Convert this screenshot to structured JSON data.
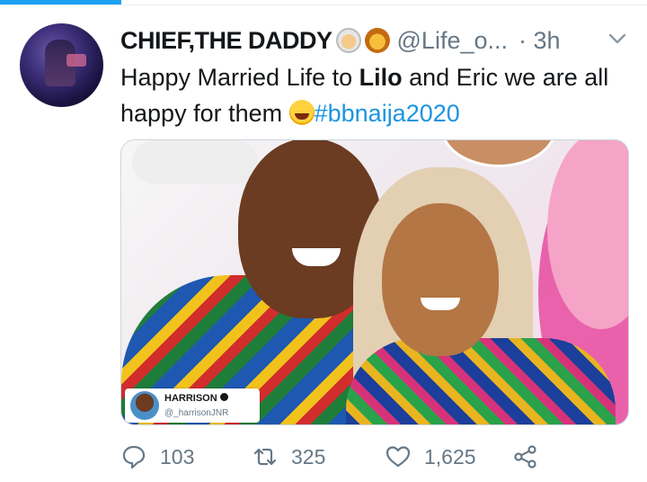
{
  "tweet": {
    "display_name": "CHIEF,THE DADDY",
    "handle": "@Life_o...",
    "separator": "·",
    "time": "3h",
    "text_part1": "Happy Married Life to ",
    "text_bold1": "Lilo",
    "text_part2": " and Eric we are all happy for them ",
    "hashtag": "#bbnaija2020",
    "emojis": [
      "old-man-emoji",
      "lion-emoji",
      "laughing-face-emoji"
    ]
  },
  "media": {
    "credit_name": "HARRISON",
    "credit_handle": "@_harrisonJNR"
  },
  "actions": {
    "replies": "103",
    "retweets": "325",
    "likes": "1,625"
  },
  "colors": {
    "accent": "#1da1f2",
    "hashtag": "#1b95e0",
    "muted": "#657786",
    "text": "#14171a"
  },
  "icons": {
    "reply": "speech-bubble-icon",
    "retweet": "retweet-arrows-icon",
    "like": "heart-icon",
    "share": "share-icon",
    "more": "chevron-down-icon"
  }
}
